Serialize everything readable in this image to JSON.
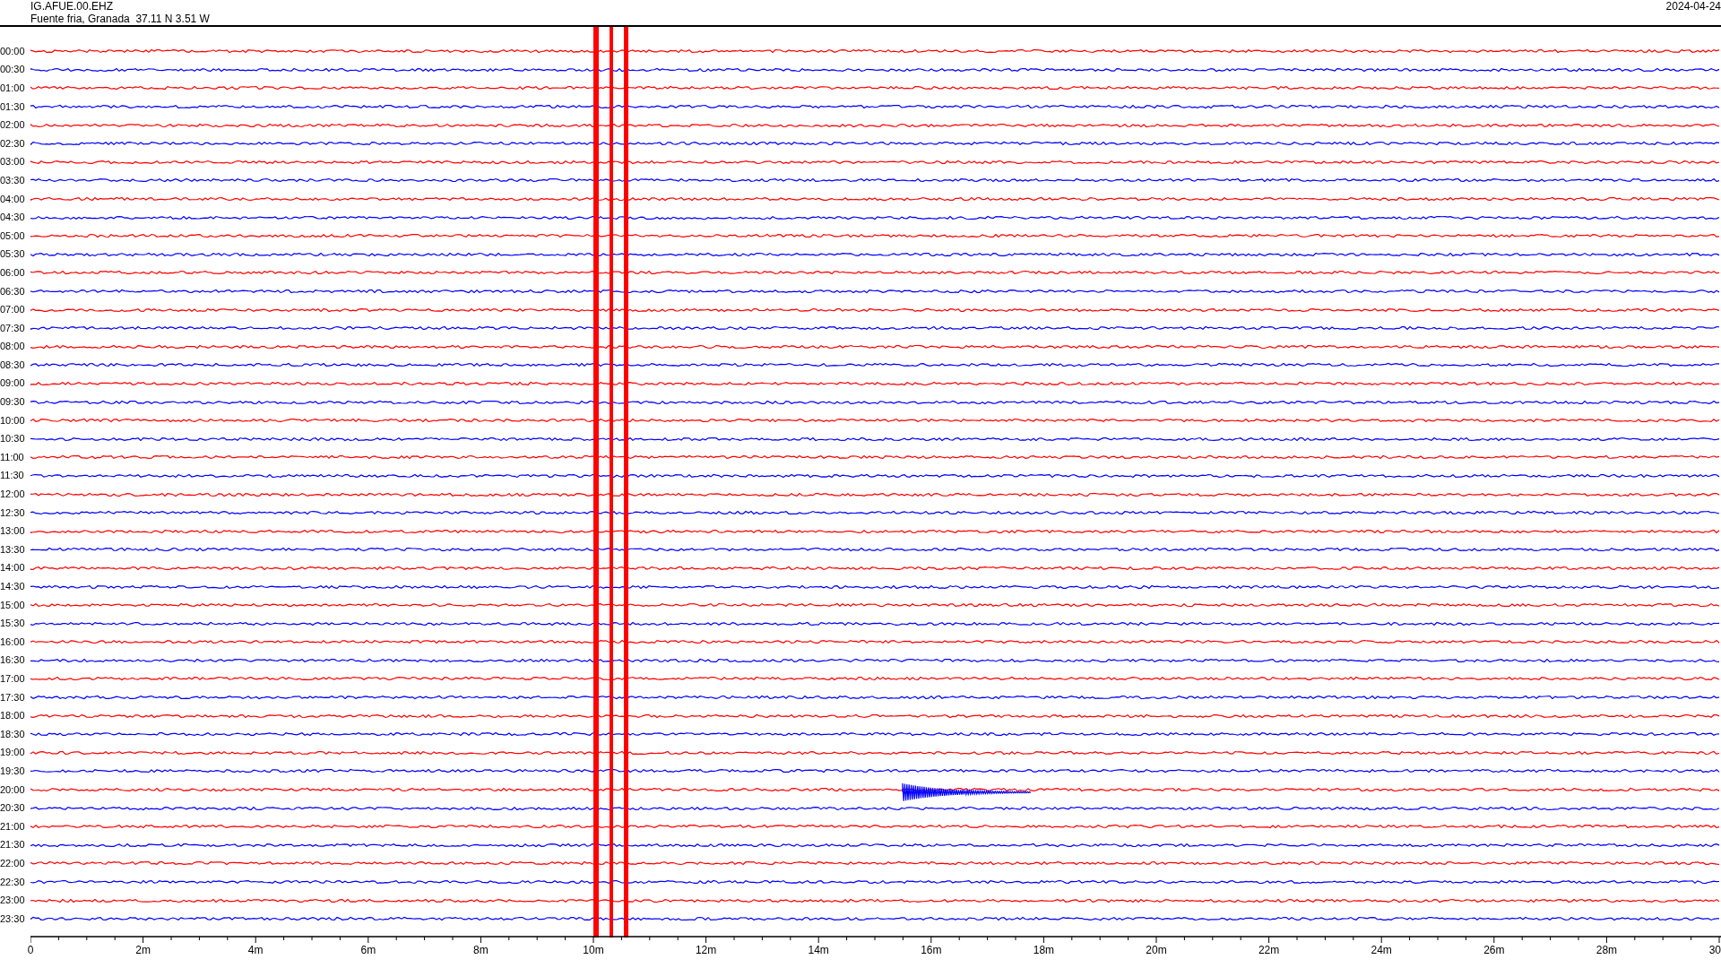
{
  "header": {
    "station": "IG.AFUE.00.EHZ",
    "location": "Fuente fria, Granada  37.11 N 3.51 W",
    "date": "2024-04-24"
  },
  "rows": [
    {
      "time": "00:00",
      "color": "#ff0000"
    },
    {
      "time": "00:30",
      "color": "#0000ff"
    },
    {
      "time": "01:00",
      "color": "#ff0000"
    },
    {
      "time": "01:30",
      "color": "#0000ff"
    },
    {
      "time": "02:00",
      "color": "#ff0000"
    },
    {
      "time": "02:30",
      "color": "#0000ff"
    },
    {
      "time": "03:00",
      "color": "#ff0000"
    },
    {
      "time": "03:30",
      "color": "#0000ff"
    },
    {
      "time": "04:00",
      "color": "#ff0000"
    },
    {
      "time": "04:30",
      "color": "#0000ff"
    },
    {
      "time": "05:00",
      "color": "#ff0000"
    },
    {
      "time": "05:30",
      "color": "#0000ff"
    },
    {
      "time": "06:00",
      "color": "#ff0000"
    },
    {
      "time": "06:30",
      "color": "#0000ff"
    },
    {
      "time": "07:00",
      "color": "#ff0000"
    },
    {
      "time": "07:30",
      "color": "#0000ff"
    },
    {
      "time": "08:00",
      "color": "#ff0000"
    },
    {
      "time": "08:30",
      "color": "#0000ff"
    },
    {
      "time": "09:00",
      "color": "#ff0000"
    },
    {
      "time": "09:30",
      "color": "#0000ff"
    },
    {
      "time": "10:00",
      "color": "#ff0000"
    },
    {
      "time": "10:30",
      "color": "#0000ff"
    },
    {
      "time": "11:00",
      "color": "#ff0000"
    },
    {
      "time": "11:30",
      "color": "#0000ff"
    },
    {
      "time": "12:00",
      "color": "#ff0000"
    },
    {
      "time": "12:30",
      "color": "#0000ff"
    },
    {
      "time": "13:00",
      "color": "#ff0000"
    },
    {
      "time": "13:30",
      "color": "#0000ff"
    },
    {
      "time": "14:00",
      "color": "#ff0000"
    },
    {
      "time": "14:30",
      "color": "#0000ff"
    },
    {
      "time": "15:00",
      "color": "#ff0000"
    },
    {
      "time": "15:30",
      "color": "#0000ff"
    },
    {
      "time": "16:00",
      "color": "#ff0000"
    },
    {
      "time": "16:30",
      "color": "#0000ff"
    },
    {
      "time": "17:00",
      "color": "#ff0000"
    },
    {
      "time": "17:30",
      "color": "#0000ff"
    },
    {
      "time": "18:00",
      "color": "#ff0000"
    },
    {
      "time": "18:30",
      "color": "#0000ff"
    },
    {
      "time": "19:00",
      "color": "#ff0000"
    },
    {
      "time": "19:30",
      "color": "#0000ff"
    },
    {
      "time": "20:00",
      "color": "#ff0000"
    },
    {
      "time": "20:30",
      "color": "#0000ff"
    },
    {
      "time": "21:00",
      "color": "#ff0000"
    },
    {
      "time": "21:30",
      "color": "#0000ff"
    },
    {
      "time": "22:00",
      "color": "#ff0000"
    },
    {
      "time": "22:30",
      "color": "#0000ff"
    },
    {
      "time": "23:00",
      "color": "#ff0000"
    },
    {
      "time": "23:30",
      "color": "#0000ff"
    }
  ],
  "x_axis": {
    "labels": [
      "0",
      "2m",
      "4m",
      "6m",
      "8m",
      "10m",
      "12m",
      "14m",
      "16m",
      "18m",
      "20m",
      "22m",
      "24m",
      "26m",
      "28m",
      "30"
    ]
  }
}
